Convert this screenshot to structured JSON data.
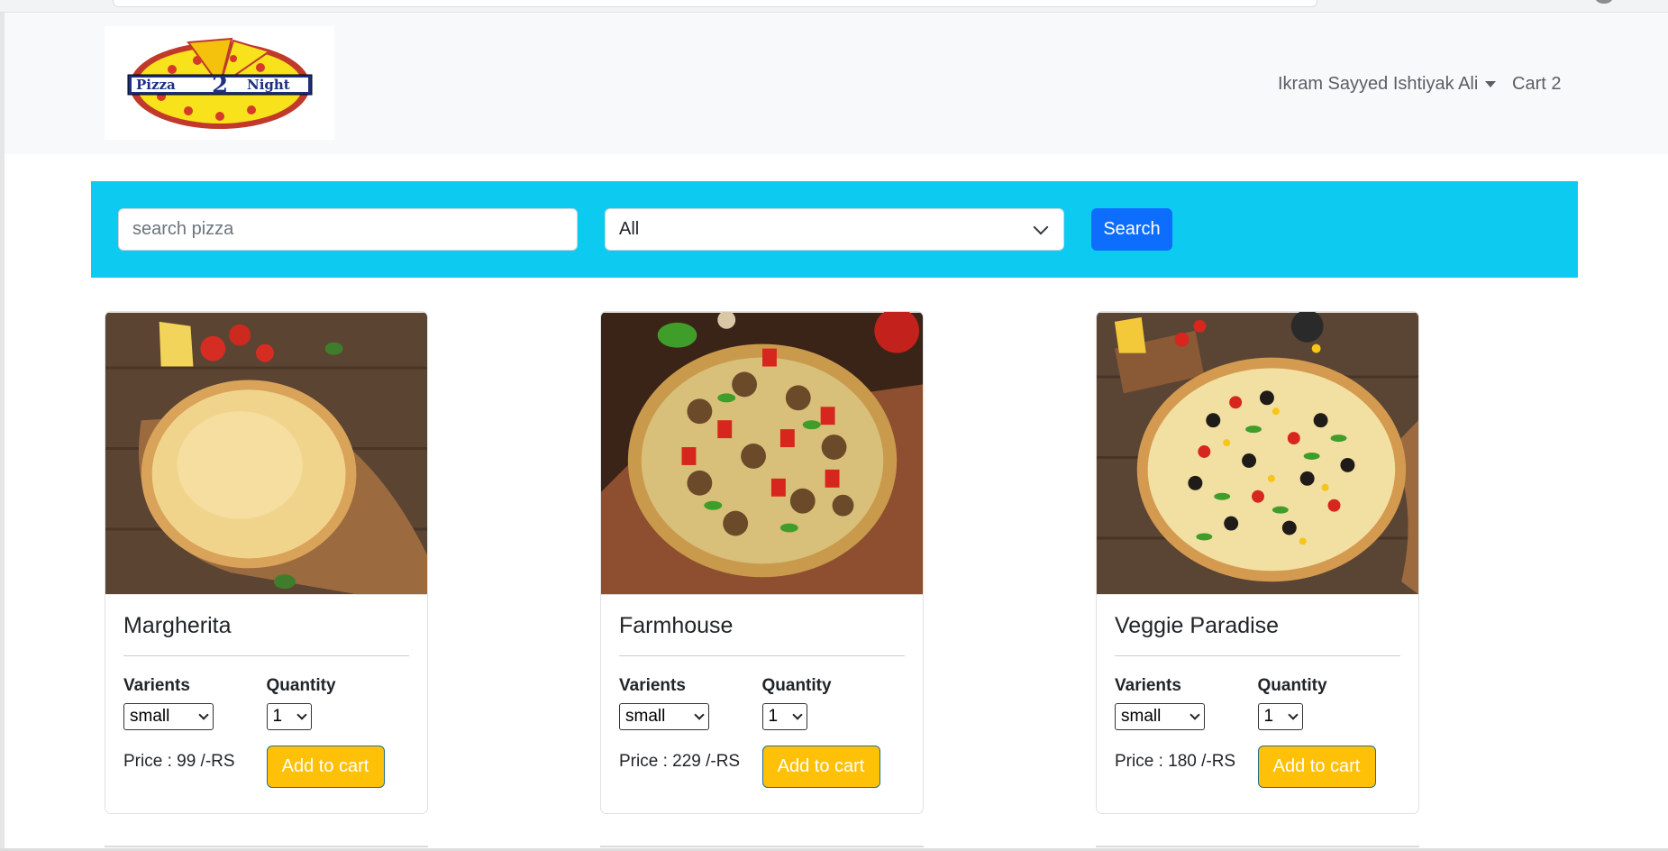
{
  "navbar": {
    "logo_alt": "Pizza 2 Night",
    "user_name": "Ikram Sayyed Ishtiyak Ali",
    "cart_label": "Cart 2"
  },
  "filter": {
    "search_placeholder": "search pizza",
    "category_value": "All",
    "search_button": "Search"
  },
  "products": [
    {
      "name": "Margherita",
      "varients_label": "Varients",
      "quantity_label": "Quantity",
      "variant": "small",
      "quantity": "1",
      "price": "Price : 99 /-RS",
      "button": "Add to cart"
    },
    {
      "name": "Farmhouse",
      "varients_label": "Varients",
      "quantity_label": "Quantity",
      "variant": "small",
      "quantity": "1",
      "price": "Price : 229 /-RS",
      "button": "Add to cart"
    },
    {
      "name": "Veggie Paradise",
      "varients_label": "Varients",
      "quantity_label": "Quantity",
      "variant": "small",
      "quantity": "1",
      "price": "Price : 180 /-RS",
      "button": "Add to cart"
    }
  ],
  "colors": {
    "filter_bar": "#0dcaf0",
    "search_button": "#0d6efd",
    "add_to_cart": "#ffc107",
    "navbar_bg": "#f8f9fa"
  }
}
